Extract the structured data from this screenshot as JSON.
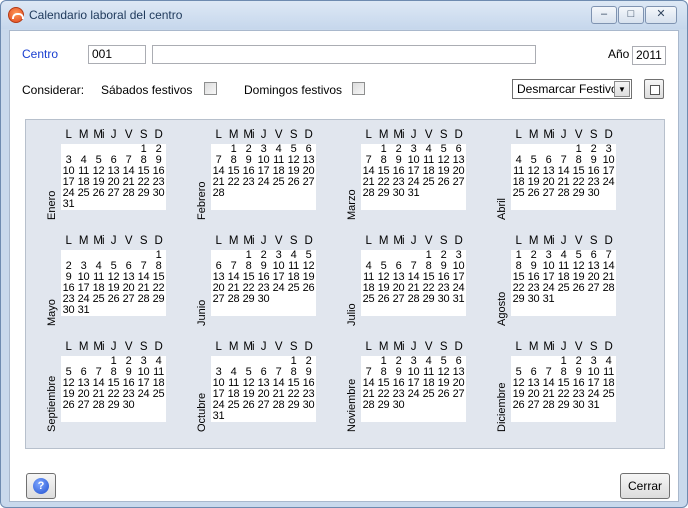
{
  "window": {
    "title": "Calendario laboral del centro"
  },
  "form": {
    "centro_label": "Centro",
    "centro_code": "001",
    "centro_name": "",
    "year_label": "Año",
    "year_value": "2011",
    "considerar_label": "Considerar:",
    "sabados_label": "Sábados festivos",
    "sabados_checked": false,
    "domingos_label": "Domingos festivos",
    "domingos_checked": false,
    "action_select_value": "Desmarcar Festivos"
  },
  "weekday_headers": [
    "L",
    "M",
    "Mi",
    "J",
    "V",
    "S",
    "D"
  ],
  "months": [
    {
      "name": "Enero",
      "weeks": [
        [
          "",
          "",
          "",
          "",
          "",
          "1",
          "2"
        ],
        [
          "3",
          "4",
          "5",
          "6",
          "7",
          "8",
          "9"
        ],
        [
          "10",
          "11",
          "12",
          "13",
          "14",
          "15",
          "16"
        ],
        [
          "17",
          "18",
          "19",
          "20",
          "21",
          "22",
          "23"
        ],
        [
          "24",
          "25",
          "26",
          "27",
          "28",
          "29",
          "30"
        ],
        [
          "31",
          "",
          "",
          "",
          "",
          "",
          ""
        ]
      ]
    },
    {
      "name": "Febrero",
      "weeks": [
        [
          "",
          "1",
          "2",
          "3",
          "4",
          "5",
          "6"
        ],
        [
          "7",
          "8",
          "9",
          "10",
          "11",
          "12",
          "13"
        ],
        [
          "14",
          "15",
          "16",
          "17",
          "18",
          "19",
          "20"
        ],
        [
          "21",
          "22",
          "23",
          "24",
          "25",
          "26",
          "27"
        ],
        [
          "28",
          "",
          "",
          "",
          "",
          "",
          ""
        ]
      ]
    },
    {
      "name": "Marzo",
      "weeks": [
        [
          "",
          "1",
          "2",
          "3",
          "4",
          "5",
          "6"
        ],
        [
          "7",
          "8",
          "9",
          "10",
          "11",
          "12",
          "13"
        ],
        [
          "14",
          "15",
          "16",
          "17",
          "18",
          "19",
          "20"
        ],
        [
          "21",
          "22",
          "23",
          "24",
          "25",
          "26",
          "27"
        ],
        [
          "28",
          "29",
          "30",
          "31",
          "",
          "",
          ""
        ]
      ]
    },
    {
      "name": "Abril",
      "weeks": [
        [
          "",
          "",
          "",
          "",
          "1",
          "2",
          "3"
        ],
        [
          "4",
          "5",
          "6",
          "7",
          "8",
          "9",
          "10"
        ],
        [
          "11",
          "12",
          "13",
          "14",
          "15",
          "16",
          "17"
        ],
        [
          "18",
          "19",
          "20",
          "21",
          "22",
          "23",
          "24"
        ],
        [
          "25",
          "26",
          "27",
          "28",
          "29",
          "30",
          ""
        ]
      ]
    },
    {
      "name": "Mayo",
      "weeks": [
        [
          "",
          "",
          "",
          "",
          "",
          "",
          "1"
        ],
        [
          "2",
          "3",
          "4",
          "5",
          "6",
          "7",
          "8"
        ],
        [
          "9",
          "10",
          "11",
          "12",
          "13",
          "14",
          "15"
        ],
        [
          "16",
          "17",
          "18",
          "19",
          "20",
          "21",
          "22"
        ],
        [
          "23",
          "24",
          "25",
          "26",
          "27",
          "28",
          "29"
        ],
        [
          "30",
          "31",
          "",
          "",
          "",
          "",
          ""
        ]
      ]
    },
    {
      "name": "Junio",
      "weeks": [
        [
          "",
          "",
          "1",
          "2",
          "3",
          "4",
          "5"
        ],
        [
          "6",
          "7",
          "8",
          "9",
          "10",
          "11",
          "12"
        ],
        [
          "13",
          "14",
          "15",
          "16",
          "17",
          "18",
          "19"
        ],
        [
          "20",
          "21",
          "22",
          "23",
          "24",
          "25",
          "26"
        ],
        [
          "27",
          "28",
          "29",
          "30",
          "",
          "",
          ""
        ]
      ]
    },
    {
      "name": "Julio",
      "weeks": [
        [
          "",
          "",
          "",
          "",
          "1",
          "2",
          "3"
        ],
        [
          "4",
          "5",
          "6",
          "7",
          "8",
          "9",
          "10"
        ],
        [
          "11",
          "12",
          "13",
          "14",
          "15",
          "16",
          "17"
        ],
        [
          "18",
          "19",
          "20",
          "21",
          "22",
          "23",
          "24"
        ],
        [
          "25",
          "26",
          "27",
          "28",
          "29",
          "30",
          "31"
        ]
      ]
    },
    {
      "name": "Agosto",
      "weeks": [
        [
          "1",
          "2",
          "3",
          "4",
          "5",
          "6",
          "7"
        ],
        [
          "8",
          "9",
          "10",
          "11",
          "12",
          "13",
          "14"
        ],
        [
          "15",
          "16",
          "17",
          "18",
          "19",
          "20",
          "21"
        ],
        [
          "22",
          "23",
          "24",
          "25",
          "26",
          "27",
          "28"
        ],
        [
          "29",
          "30",
          "31",
          "",
          "",
          "",
          ""
        ]
      ]
    },
    {
      "name": "Septiembre",
      "weeks": [
        [
          "",
          "",
          "",
          "1",
          "2",
          "3",
          "4"
        ],
        [
          "5",
          "6",
          "7",
          "8",
          "9",
          "10",
          "11"
        ],
        [
          "12",
          "13",
          "14",
          "15",
          "16",
          "17",
          "18"
        ],
        [
          "19",
          "20",
          "21",
          "22",
          "23",
          "24",
          "25"
        ],
        [
          "26",
          "27",
          "28",
          "29",
          "30",
          "",
          ""
        ]
      ]
    },
    {
      "name": "Octubre",
      "weeks": [
        [
          "",
          "",
          "",
          "",
          "",
          "1",
          "2"
        ],
        [
          "3",
          "4",
          "5",
          "6",
          "7",
          "8",
          "9"
        ],
        [
          "10",
          "11",
          "12",
          "13",
          "14",
          "15",
          "16"
        ],
        [
          "17",
          "18",
          "19",
          "20",
          "21",
          "22",
          "23"
        ],
        [
          "24",
          "25",
          "26",
          "27",
          "28",
          "29",
          "30"
        ],
        [
          "31",
          "",
          "",
          "",
          "",
          "",
          ""
        ]
      ]
    },
    {
      "name": "Noviembre",
      "weeks": [
        [
          "",
          "1",
          "2",
          "3",
          "4",
          "5",
          "6"
        ],
        [
          "7",
          "8",
          "9",
          "10",
          "11",
          "12",
          "13"
        ],
        [
          "14",
          "15",
          "16",
          "17",
          "18",
          "19",
          "20"
        ],
        [
          "21",
          "22",
          "23",
          "24",
          "25",
          "26",
          "27"
        ],
        [
          "28",
          "29",
          "30",
          "",
          "",
          "",
          ""
        ]
      ]
    },
    {
      "name": "Diciembre",
      "weeks": [
        [
          "",
          "",
          "",
          "1",
          "2",
          "3",
          "4"
        ],
        [
          "5",
          "6",
          "7",
          "8",
          "9",
          "10",
          "11"
        ],
        [
          "12",
          "13",
          "14",
          "15",
          "16",
          "17",
          "18"
        ],
        [
          "19",
          "20",
          "21",
          "22",
          "23",
          "24",
          "25"
        ],
        [
          "26",
          "27",
          "28",
          "29",
          "30",
          "31",
          ""
        ]
      ]
    }
  ],
  "footer": {
    "help_icon": "help-icon",
    "close_label": "Cerrar"
  }
}
